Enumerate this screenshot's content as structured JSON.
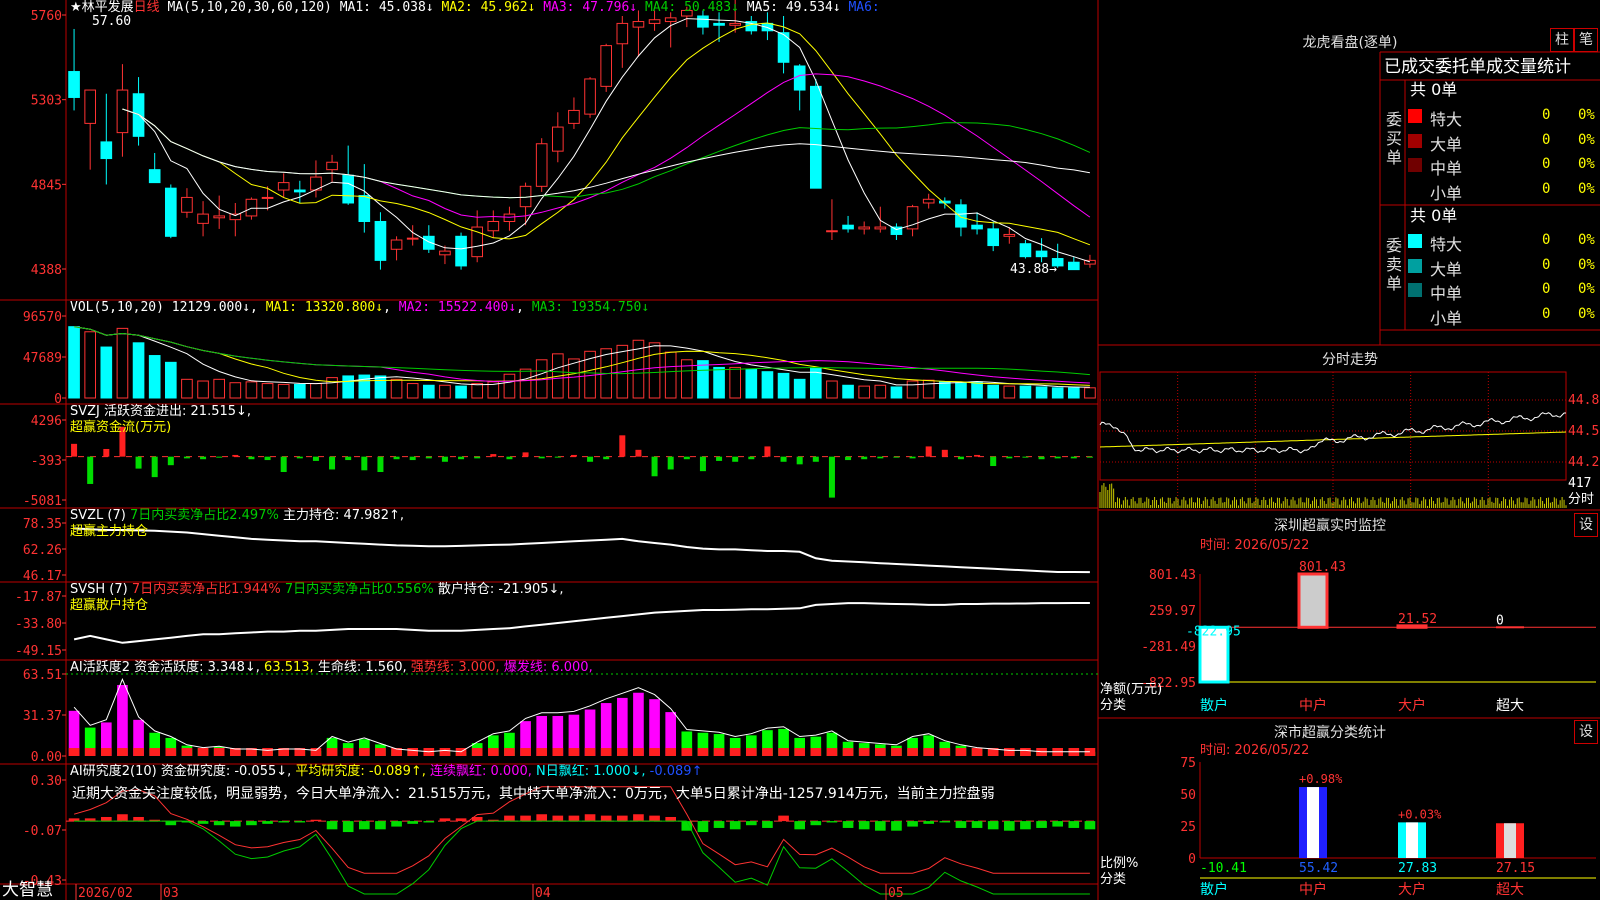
{
  "app": {
    "brand": "大智慧"
  },
  "stock": {
    "name": "★林平发展",
    "period": "日线"
  },
  "colors": {
    "up": "#ff3333",
    "down": "#00ffff",
    "grid": "#bb0000",
    "ma1": "#ffffff",
    "ma2": "#ffff00",
    "ma3": "#ff00ff",
    "ma4": "#00cc00",
    "ma5": "#ffffff"
  },
  "kline": {
    "indicator": "MA(5,10,20,30,60,120)",
    "legend": [
      {
        "label": "MA1: 45.038↓",
        "color": "#ffffff"
      },
      {
        "label": "MA2: 45.962↓",
        "color": "#ffff00"
      },
      {
        "label": "MA3: 47.796↓",
        "color": "#ff00ff"
      },
      {
        "label": "MA4: 50.483↓",
        "color": "#00cc00"
      },
      {
        "label": "MA5: 49.534↓",
        "color": "#ffffff"
      },
      {
        "label": "MA6:",
        "color": "#2050ff"
      }
    ],
    "yticks": [
      "5760",
      "5303",
      "4845",
      "4388"
    ],
    "high_label": "57.60",
    "low_label": "43.88→"
  },
  "vol": {
    "title": "VOL(5,10,20)",
    "legend": [
      {
        "label": "12129.000↓",
        "color": "#ffffff"
      },
      {
        "label": "MA1: 13320.800↓",
        "color": "#ffff00"
      },
      {
        "label": "MA2: 15522.400↓",
        "color": "#ff00ff"
      },
      {
        "label": "MA3: 19354.750↓",
        "color": "#00cc00"
      }
    ],
    "yticks": [
      "96570",
      "47689",
      "0"
    ]
  },
  "svzj": {
    "line1": "SVZJ  活跃资金进出: 21.515↓,",
    "line2": "超赢资金流(万元)",
    "yticks": [
      "4296",
      "-393",
      "-5081"
    ]
  },
  "svzl": {
    "prefix": "SVZL (7)",
    "a": "7日内买卖净占比2.497%",
    "b": "主力持仓: 47.982↑,",
    "line2": "超赢主力持仓",
    "yticks": [
      "78.35",
      "62.26",
      "46.17"
    ]
  },
  "svsh": {
    "prefix": "SVSH (7)",
    "a": "7日内买卖净占比1.944%",
    "b": "7日内买卖净占比0.556%",
    "c": "散户持仓: -21.905↓,",
    "line2": "超赢散户持仓",
    "yticks": [
      "-17.87",
      "-33.80",
      "-49.15"
    ]
  },
  "ai_active": {
    "prefix": "AI活跃度2",
    "a": "资金活跃度: 3.348↓,",
    "b": "63.513,",
    "c": "生命线: 1.560,",
    "d": "强势线: 3.000,",
    "e": "爆发线: 6.000,",
    "yticks": [
      "63.51",
      "31.37",
      "0.00"
    ]
  },
  "ai_research": {
    "prefix": "AI研究度2(10)",
    "a": "资金研究度: -0.055↓,",
    "b": "平均研究度: -0.089↑,",
    "c": "连续飘红: 0.000,",
    "d": "N日飘红: 1.000↓,",
    "e": "-0.089↑",
    "comment": "近期大资金关注度较低，明显弱势，今日大单净流入：21.515万元，其中特大单净流入：0万元，大单5日累计净出-1257.914万元，当前主力控盘弱",
    "yticks": [
      "0.30",
      "-0.07",
      "-0.43"
    ]
  },
  "xaxis": {
    "labels": [
      "2026/02",
      "03",
      "04",
      "05"
    ]
  },
  "right": {
    "dragon_title": "龙虎看盘(逐单)",
    "btn_bar": "柱",
    "btn_pen": "笔",
    "tabs": [
      "已成交",
      "委托单",
      "成交量统计"
    ],
    "buy": {
      "label": "委买单",
      "total": "共 0单",
      "rows": [
        {
          "name": "特大",
          "count": "0",
          "pct": "0%",
          "color": "#ff0000"
        },
        {
          "name": "大单",
          "count": "0",
          "pct": "0%",
          "color": "#a00000"
        },
        {
          "name": "中单",
          "count": "0",
          "pct": "0%",
          "color": "#700000"
        },
        {
          "name": "小单",
          "count": "0",
          "pct": "0%",
          "color": "#000000"
        }
      ]
    },
    "sell": {
      "label": "委卖单",
      "total": "共 0单",
      "rows": [
        {
          "name": "特大",
          "count": "0",
          "pct": "0%",
          "color": "#00ffff"
        },
        {
          "name": "大单",
          "count": "0",
          "pct": "0%",
          "color": "#00a0a0"
        },
        {
          "name": "中单",
          "count": "0",
          "pct": "0%",
          "color": "#007070"
        },
        {
          "name": "小单",
          "count": "0",
          "pct": "0%",
          "color": "#000000"
        }
      ]
    },
    "intraday": {
      "title": "分时走势",
      "yticks": [
        "44.83",
        "44.52",
        "44.21"
      ],
      "vol_label": "417",
      "unit": "分时"
    },
    "monitor": {
      "title": "深圳超赢实时监控",
      "btn": "设",
      "time": "时间: 2026/05/22",
      "yticks": [
        "801.43",
        "259.97",
        "-281.49",
        "-822.95"
      ],
      "values": [
        {
          "cat": "散户",
          "value": -822.95,
          "label": "-822.95"
        },
        {
          "cat": "中户",
          "value": 801.43,
          "label": "801.43"
        },
        {
          "cat": "大户",
          "value": 21.52,
          "label": "21.52"
        },
        {
          "cat": "超大",
          "value": 0,
          "label": "0"
        }
      ],
      "ylabel": "净额(万元)",
      "xlabel": "分类",
      "cats": [
        "散户",
        "中户",
        "大户",
        "超大"
      ]
    },
    "stats": {
      "title": "深市超赢分类统计",
      "btn": "设",
      "time": "时间: 2026/05/22",
      "yticks": [
        "75",
        "50",
        "25",
        "0"
      ],
      "bars": [
        {
          "cat": "散户",
          "value": -10.41,
          "label": "-10.41",
          "delta": ""
        },
        {
          "cat": "中户",
          "value": 55.42,
          "label": "55.42",
          "delta": "+0.98%"
        },
        {
          "cat": "大户",
          "value": 27.83,
          "label": "27.83",
          "delta": "+0.03%"
        },
        {
          "cat": "超大",
          "value": 27.15,
          "label": "27.15",
          "delta": ""
        }
      ],
      "ylabel": "比例%",
      "xlabel": "分类",
      "cats": [
        "散户",
        "中户",
        "大户",
        "超大"
      ]
    }
  },
  "chart_data": [
    {
      "type": "candlestick",
      "title": "★林平发展 日线",
      "ylim": [
        43.88,
        57.6
      ],
      "candles": [
        [
          54.6,
          56.9,
          52.5,
          53.2
        ],
        [
          51.8,
          53.6,
          49.3,
          53.6
        ],
        [
          50.8,
          53.4,
          48.5,
          49.9
        ],
        [
          51.3,
          55.0,
          50.0,
          53.6
        ],
        [
          53.4,
          54.3,
          50.6,
          51.1
        ],
        [
          49.3,
          50.2,
          48.6,
          48.6
        ],
        [
          48.3,
          48.5,
          45.6,
          45.7
        ],
        [
          47.0,
          48.3,
          46.7,
          47.8
        ],
        [
          46.4,
          47.6,
          45.7,
          46.9
        ],
        [
          46.7,
          47.9,
          46.1,
          46.8
        ],
        [
          46.6,
          47.5,
          45.7,
          46.9
        ],
        [
          46.8,
          47.8,
          46.6,
          47.7
        ],
        [
          47.8,
          48.4,
          47.1,
          47.8
        ],
        [
          48.2,
          49.1,
          47.8,
          48.6
        ],
        [
          48.2,
          48.7,
          47.5,
          48.1
        ],
        [
          48.2,
          49.8,
          47.8,
          48.9
        ],
        [
          49.3,
          50.1,
          48.6,
          49.7
        ],
        [
          49.0,
          50.6,
          47.4,
          47.5
        ],
        [
          47.9,
          49.6,
          45.9,
          46.5
        ],
        [
          46.5,
          47.0,
          43.9,
          44.4
        ],
        [
          45.0,
          45.7,
          44.4,
          45.5
        ],
        [
          45.6,
          46.3,
          45.2,
          45.6
        ],
        [
          45.7,
          46.3,
          44.8,
          45.0
        ],
        [
          44.7,
          45.2,
          44.2,
          44.9
        ],
        [
          45.7,
          45.9,
          43.9,
          44.1
        ],
        [
          44.6,
          47.1,
          44.3,
          46.2
        ],
        [
          46.0,
          47.1,
          45.6,
          46.5
        ],
        [
          46.5,
          47.3,
          46.0,
          46.9
        ],
        [
          47.3,
          48.6,
          46.3,
          48.4
        ],
        [
          48.4,
          51.0,
          48.1,
          50.7
        ],
        [
          50.3,
          52.4,
          49.7,
          51.6
        ],
        [
          51.8,
          53.2,
          51.5,
          52.5
        ],
        [
          52.3,
          54.3,
          52.1,
          54.2
        ],
        [
          53.8,
          56.1,
          53.5,
          56.0
        ],
        [
          56.1,
          57.6,
          54.8,
          57.2
        ],
        [
          57.0,
          57.9,
          55.4,
          57.3
        ],
        [
          57.2,
          57.9,
          56.8,
          57.4
        ],
        [
          57.3,
          57.8,
          55.9,
          57.5
        ],
        [
          57.6,
          58.1,
          57.0,
          57.9
        ],
        [
          57.6,
          57.9,
          56.6,
          57.0
        ],
        [
          57.2,
          57.8,
          56.2,
          57.1
        ],
        [
          57.1,
          58.5,
          56.7,
          57.2
        ],
        [
          57.3,
          57.6,
          56.6,
          56.8
        ],
        [
          57.2,
          57.8,
          56.3,
          56.8
        ],
        [
          56.7,
          57.6,
          54.5,
          55.1
        ],
        [
          54.9,
          55.0,
          52.5,
          53.6
        ],
        [
          53.8,
          54.2,
          49.0,
          48.3
        ],
        [
          46.0,
          47.7,
          45.5,
          46.0
        ],
        [
          46.3,
          46.8,
          45.9,
          46.1
        ],
        [
          46.1,
          46.5,
          45.8,
          46.2
        ],
        [
          46.1,
          47.3,
          45.9,
          46.2
        ],
        [
          46.2,
          46.4,
          45.5,
          45.8
        ],
        [
          46.1,
          47.4,
          45.7,
          47.3
        ],
        [
          47.5,
          48.0,
          47.2,
          47.7
        ],
        [
          47.6,
          47.8,
          47.2,
          47.5
        ],
        [
          47.4,
          47.7,
          45.7,
          46.2
        ],
        [
          46.3,
          47.0,
          45.8,
          46.1
        ],
        [
          46.1,
          46.5,
          44.9,
          45.2
        ],
        [
          45.7,
          46.2,
          45.3,
          45.8
        ],
        [
          45.3,
          45.5,
          44.5,
          44.6
        ],
        [
          44.9,
          45.6,
          44.3,
          44.6
        ],
        [
          44.5,
          45.3,
          44.0,
          44.1
        ],
        [
          44.3,
          44.6,
          43.9,
          43.9
        ],
        [
          44.2,
          44.7,
          44.0,
          44.4
        ]
      ]
    },
    {
      "type": "bar",
      "title": "VOL(5,10,20)",
      "ylim": [
        0,
        96570
      ],
      "values": [
        84000,
        78000,
        60000,
        82000,
        65000,
        50000,
        42000,
        22000,
        20000,
        22000,
        18000,
        19000,
        17000,
        16000,
        16000,
        17000,
        24000,
        26000,
        27000,
        26000,
        22000,
        17000,
        15000,
        15000,
        14000,
        17000,
        19000,
        28000,
        34000,
        45000,
        52000,
        46000,
        55000,
        58000,
        62000,
        68000,
        65000,
        54000,
        45000,
        44000,
        36000,
        36000,
        34000,
        31000,
        29000,
        22000,
        36000,
        20000,
        15000,
        14000,
        15000,
        13000,
        20000,
        21000,
        19000,
        18000,
        19000,
        15000,
        14000,
        14000,
        13000,
        12000,
        12000,
        12000
      ]
    },
    {
      "type": "bar",
      "title": "超赢资金流(万元)",
      "ylim": [
        -5081,
        4296
      ],
      "values": [
        1500,
        -3200,
        900,
        3500,
        -1400,
        -2400,
        -1000,
        -200,
        -300,
        -100,
        200,
        -300,
        -400,
        -1800,
        -200,
        -500,
        -1500,
        -400,
        -1600,
        -1800,
        -300,
        -400,
        -200,
        -600,
        -300,
        -200,
        300,
        -300,
        500,
        -200,
        -100,
        200,
        -600,
        -300,
        2500,
        800,
        -2300,
        -1500,
        -300,
        -1700,
        -500,
        -600,
        -300,
        1200,
        -600,
        -900,
        -600,
        -4800,
        -400,
        -300,
        -200,
        -100,
        -200,
        1200,
        800,
        -300,
        200,
        -1100,
        -200,
        -100,
        -300,
        -200,
        -200,
        -100
      ]
    },
    {
      "type": "line",
      "title": "超赢主力持仓",
      "ylim": [
        46.17,
        78.35
      ],
      "values": [
        75.0,
        74.5,
        74.0,
        74.0,
        73.8,
        73.5,
        73.0,
        72.5,
        71.5,
        70.5,
        69.5,
        68.5,
        68.0,
        67.5,
        67.0,
        67.0,
        66.5,
        66.0,
        65.5,
        65.0,
        64.5,
        64.3,
        64.0,
        64.0,
        64.2,
        64.5,
        64.8,
        65.0,
        65.5,
        66.0,
        66.5,
        67.0,
        67.5,
        68.0,
        68.5,
        67.0,
        66.0,
        65.0,
        63.5,
        62.5,
        62.0,
        62.0,
        61.5,
        61.0,
        61.0,
        60.5,
        56.5,
        55.0,
        54.5,
        54.0,
        53.5,
        53.0,
        52.5,
        52.0,
        51.5,
        51.0,
        50.5,
        50.0,
        49.5,
        49.0,
        48.5,
        48.0,
        48.0,
        47.98
      ]
    },
    {
      "type": "line",
      "title": "超赢散户持仓",
      "ylim": [
        -49.15,
        -17.87
      ],
      "values": [
        -43.0,
        -41.0,
        -43.0,
        -45.0,
        -44.0,
        -43.0,
        -42.0,
        -41.0,
        -40.0,
        -40.0,
        -39.5,
        -39.0,
        -38.5,
        -38.5,
        -38.0,
        -38.0,
        -37.5,
        -37.0,
        -37.0,
        -37.0,
        -37.0,
        -37.5,
        -38.0,
        -38.0,
        -38.0,
        -37.5,
        -37.0,
        -36.5,
        -35.5,
        -34.5,
        -33.5,
        -32.5,
        -31.5,
        -30.5,
        -29.5,
        -28.5,
        -27.5,
        -27.0,
        -26.5,
        -26.0,
        -26.0,
        -25.8,
        -25.6,
        -25.5,
        -25.3,
        -25.0,
        -23.0,
        -22.5,
        -22.0,
        -22.0,
        -22.3,
        -22.5,
        -22.7,
        -23.0,
        -23.0,
        -22.5,
        -22.5,
        -22.3,
        -22.3,
        -22.2,
        -22.0,
        -22.0,
        -21.9,
        -21.9
      ]
    },
    {
      "type": "bar",
      "title": "AI活跃度2",
      "ylim": [
        0,
        63.51
      ],
      "values": [
        35,
        22,
        26,
        55,
        28,
        18,
        14,
        8,
        6,
        7,
        5,
        5,
        4,
        5,
        5,
        4,
        14,
        10,
        13,
        9,
        5,
        4,
        3,
        4,
        3,
        10,
        16,
        18,
        27,
        31,
        31,
        32,
        36,
        41,
        45,
        49,
        44,
        34,
        19,
        18,
        17,
        14,
        16,
        20,
        21,
        14,
        15,
        18,
        11,
        10,
        9,
        8,
        14,
        16,
        11,
        8,
        6,
        5,
        4,
        4,
        3,
        3,
        3,
        3
      ]
    },
    {
      "type": "bar",
      "title": "AI研究度2(10)",
      "ylim": [
        -0.43,
        0.3
      ],
      "values": [
        0.02,
        0.02,
        0.03,
        0.05,
        0.03,
        0.01,
        -0.03,
        -0.01,
        -0.02,
        -0.03,
        -0.04,
        -0.03,
        -0.02,
        -0.01,
        -0.01,
        0.01,
        -0.06,
        -0.08,
        -0.06,
        -0.06,
        -0.04,
        -0.02,
        -0.01,
        0.02,
        0.02,
        0.03,
        0.01,
        0.04,
        0.04,
        0.05,
        0.04,
        0.04,
        0.05,
        0.04,
        0.04,
        0.05,
        0.04,
        0.03,
        -0.07,
        -0.08,
        -0.05,
        -0.06,
        -0.03,
        -0.05,
        0.04,
        -0.06,
        -0.03,
        -0.01,
        -0.05,
        -0.06,
        -0.07,
        -0.07,
        -0.04,
        -0.02,
        -0.01,
        -0.05,
        -0.05,
        -0.06,
        -0.07,
        -0.06,
        -0.05,
        -0.04,
        -0.05,
        -0.06
      ]
    },
    {
      "type": "line",
      "title": "分时走势",
      "ylim": [
        44.21,
        44.83
      ]
    }
  ]
}
